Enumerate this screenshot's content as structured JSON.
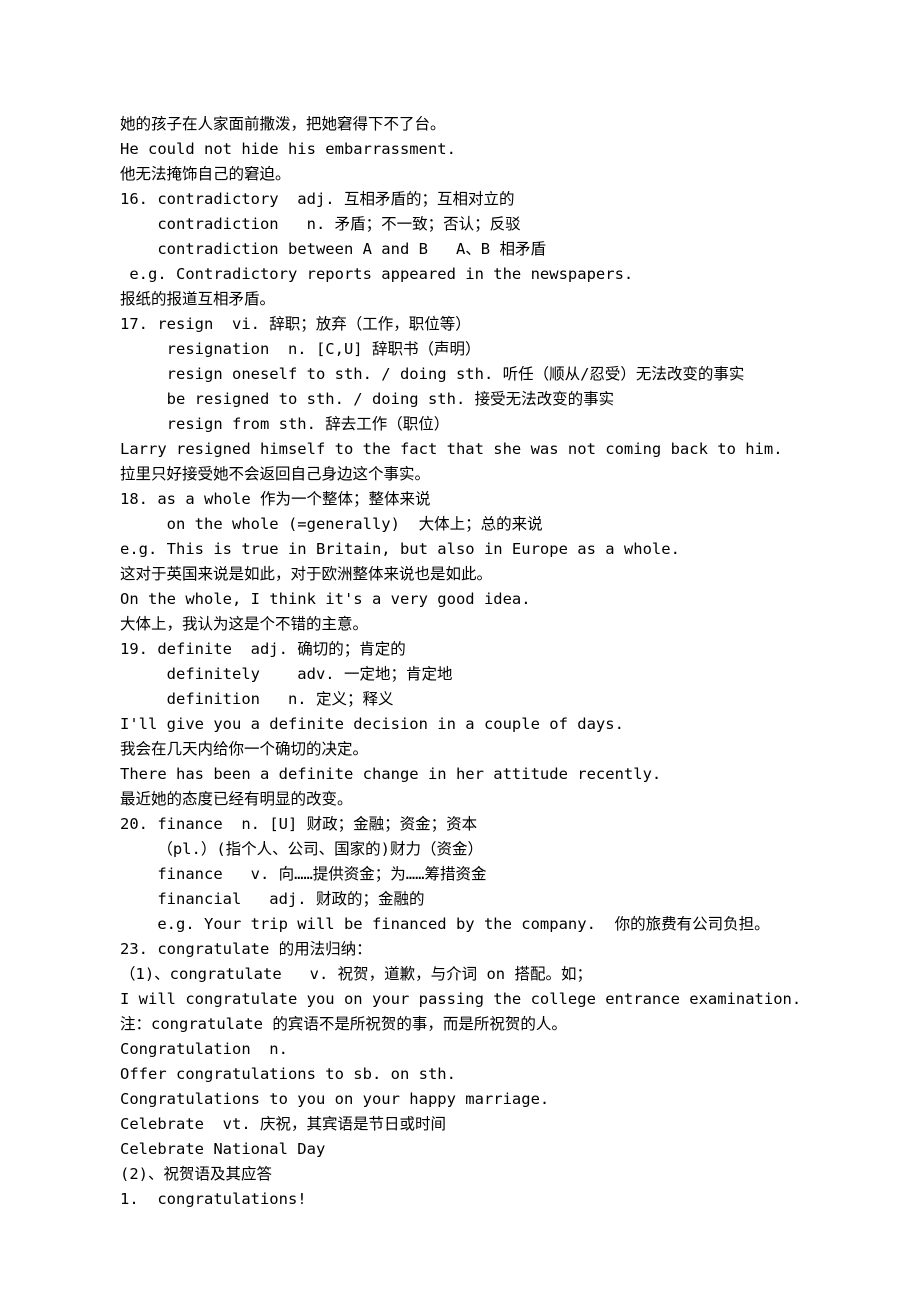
{
  "lines": [
    "她的孩子在人家面前撒泼，把她窘得下不了台。",
    "He could not hide his embarrassment.",
    "他无法掩饰自己的窘迫。",
    "16. contradictory  adj. 互相矛盾的；互相对立的",
    "    contradiction   n. 矛盾；不一致；否认；反驳",
    "    contradiction between A and B   A、B 相矛盾",
    " e.g. Contradictory reports appeared in the newspapers.",
    "报纸的报道互相矛盾。",
    "17. resign  vi. 辞职；放弃（工作，职位等）",
    "     resignation  n. [C,U] 辞职书（声明）",
    "     resign oneself to sth. / doing sth. 听任（顺从/忍受）无法改变的事实",
    "     be resigned to sth. / doing sth. 接受无法改变的事实",
    "     resign from sth. 辞去工作（职位）",
    "Larry resigned himself to the fact that she was not coming back to him.",
    "拉里只好接受她不会返回自己身边这个事实。",
    "18. as a whole 作为一个整体；整体来说",
    "     on the whole (=generally)  大体上；总的来说",
    "e.g. This is true in Britain, but also in Europe as a whole.",
    "这对于英国来说是如此，对于欧洲整体来说也是如此。",
    "On the whole, I think it's a very good idea.",
    "大体上，我认为这是个不错的主意。",
    "19. definite  adj. 确切的；肯定的",
    "     definitely    adv. 一定地；肯定地",
    "     definition   n. 定义；释义",
    "I'll give you a definite decision in a couple of days.",
    "我会在几天内给你一个确切的决定。",
    "There has been a definite change in her attitude recently.",
    "最近她的态度已经有明显的改变。",
    "20. finance  n. [U] 财政；金融；资金；资本",
    "    （pl.）(指个人、公司、国家的)财力（资金）",
    "    finance   v. 向……提供资金；为……筹措资金",
    "    financial   adj. 财政的；金融的",
    "    e.g. Your trip will be financed by the company.  你的旅费有公司负担。",
    "23. congratulate 的用法归纳：",
    "（1)、congratulate   v. 祝贺，道歉，与介词 on 搭配。如；",
    "I will congratulate you on your passing the college entrance examination.",
    "注：congratulate 的宾语不是所祝贺的事，而是所祝贺的人。",
    "Congratulation  n.",
    "Offer congratulations to sb. on sth.",
    "Congratulations to you on your happy marriage.",
    "Celebrate  vt. 庆祝，其宾语是节日或时间",
    "Celebrate National Day",
    "(2)、祝贺语及其应答",
    "1.  congratulations!"
  ]
}
